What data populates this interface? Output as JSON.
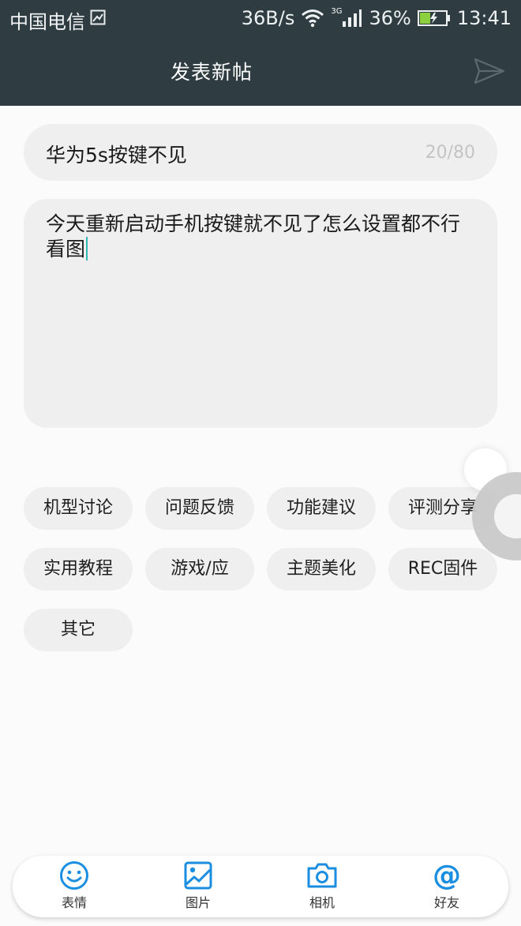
{
  "status_bar": {
    "carrier": "中国电信",
    "net_speed": "36B/s",
    "net_type": "3G",
    "battery_percent": "36%",
    "time": "13:41"
  },
  "header": {
    "title": "发表新帖",
    "send_icon": "send-icon"
  },
  "post": {
    "title_value": "华为5s按键不见",
    "title_counter": "20/80",
    "body_value": "今天重新启动手机按键就不见了怎么设置都不行看图"
  },
  "categories": [
    "机型讨论",
    "问题反馈",
    "功能建议",
    "评测分享",
    "实用教程",
    "游戏/应",
    "主题美化",
    "REC固件",
    "其它"
  ],
  "toolbar": {
    "emoji_label": "表情",
    "image_label": "图片",
    "camera_label": "相机",
    "friends_label": "好友"
  },
  "colors": {
    "header_bg": "#2f3d42",
    "accent": "#1a8ee0",
    "field_bg": "#efefef"
  }
}
